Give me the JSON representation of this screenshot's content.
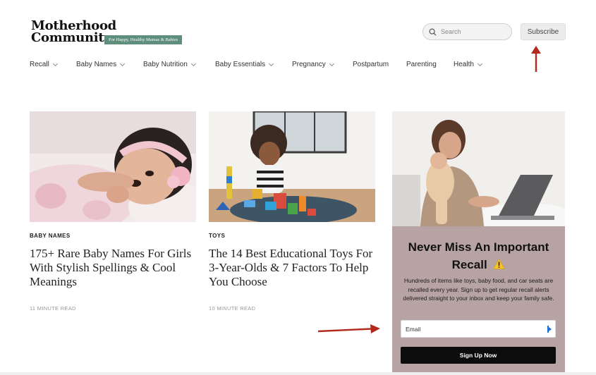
{
  "header": {
    "logo_line1": "Motherhood",
    "logo_line2": "Community",
    "logo_tagline": "For Happy, Healthy Mamas & Babies",
    "search_placeholder": "Search",
    "search_icon": "search-icon",
    "subscribe_label": "Subscribe"
  },
  "nav": {
    "items": [
      {
        "label": "Recall",
        "has_dropdown": true
      },
      {
        "label": "Baby Names",
        "has_dropdown": true
      },
      {
        "label": "Baby Nutrition",
        "has_dropdown": true
      },
      {
        "label": "Baby Essentials",
        "has_dropdown": true
      },
      {
        "label": "Pregnancy",
        "has_dropdown": true
      },
      {
        "label": "Postpartum",
        "has_dropdown": false
      },
      {
        "label": "Parenting",
        "has_dropdown": false
      },
      {
        "label": "Health",
        "has_dropdown": true
      }
    ]
  },
  "articles": [
    {
      "category": "BABY NAMES",
      "title": "175+ Rare Baby Names For Girls With Stylish Spellings & Cool Meanings",
      "read_time": "11 MINUTE READ"
    },
    {
      "category": "TOYS",
      "title": "The 14 Best Educational Toys For 3-Year-Olds & 7 Factors To Help You Choose",
      "read_time": "10 MINUTE READ"
    }
  ],
  "promo": {
    "title": "Never Miss An Important Recall",
    "warning_emoji": "⚠️",
    "body": "Hundreds of items like toys, baby food, and car seats are recalled every year. Sign up to get regular recall alerts delivered straight to your inbox and keep your family safe.",
    "email_placeholder": "Email",
    "button_label": "Sign Up Now"
  },
  "colors": {
    "brand_green": "#5f8f7c",
    "promo_bg": "#b7a3a4",
    "button_bg": "#0c0c0c",
    "annotation_arrow": "#b22a1c"
  }
}
